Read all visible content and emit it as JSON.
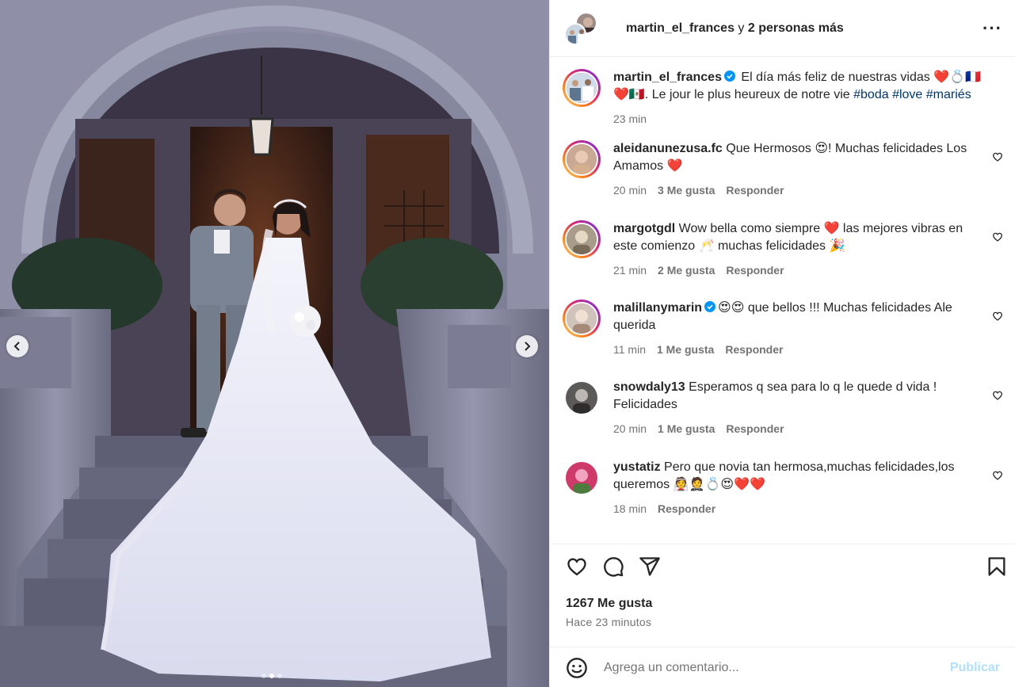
{
  "post_header": {
    "username": "martin_el_frances",
    "connector": "y",
    "others": "2 personas más",
    "more_icon": "more-horizontal-icon"
  },
  "carousel": {
    "prev_icon": "chevron-left-icon",
    "next_icon": "chevron-right-icon",
    "slide_count": 3,
    "active_slide": 2
  },
  "caption": {
    "username": "martin_el_frances",
    "verified": true,
    "text_es": "El día más feliz de nuestras vidas ❤️💍🇫🇷",
    "text_fr": "❤️🇲🇽. Le jour le plus heureux de notre vie",
    "hashtags": [
      "#boda",
      "#love",
      "#mariés"
    ],
    "time": "23 min"
  },
  "comments": [
    {
      "username": "aleidanunezusa.fc",
      "text": "Que Hermosos 😍! Muchas felicidades Los Amamos ❤️",
      "time": "20 min",
      "likes": "3 Me gusta",
      "reply": "Responder",
      "ring": true,
      "verified": false
    },
    {
      "username": "margotgdl",
      "text": "Wow bella como siempre ❤️ las mejores vibras en este comienzo 🥂 muchas felicidades 🎉",
      "time": "21 min",
      "likes": "2 Me gusta",
      "reply": "Responder",
      "ring": true,
      "verified": false
    },
    {
      "username": "malillanymarin",
      "text": "😍😍 que bellos !!! Muchas felicidades Ale querida",
      "time": "11 min",
      "likes": "1 Me gusta",
      "reply": "Responder",
      "ring": true,
      "verified": true
    },
    {
      "username": "snowdaly13",
      "text": "Esperamos q sea para lo q le quede d vida ! Felicidades",
      "time": "20 min",
      "likes": "1 Me gusta",
      "reply": "Responder",
      "ring": false,
      "verified": false
    },
    {
      "username": "yustatiz",
      "text": "Pero que novia tan hermosa,muchas felicidades,los queremos 👰🤵💍😍❤️❤️",
      "time": "18 min",
      "likes": "",
      "reply": "Responder",
      "ring": false,
      "verified": false
    }
  ],
  "actions": {
    "like_icon": "heart-icon",
    "comment_icon": "comment-icon",
    "share_icon": "send-icon",
    "save_icon": "bookmark-icon"
  },
  "likes_text": "1267 Me gusta",
  "posted_text": "Hace 23 minutos",
  "comment_box": {
    "emoji_icon": "smiley-icon",
    "placeholder": "Agrega un comentario...",
    "submit_label": "Publicar"
  },
  "colors": {
    "link": "#00376b",
    "muted": "#737373",
    "verified": "#0095f6",
    "publish_disabled": "#b2dffc"
  }
}
